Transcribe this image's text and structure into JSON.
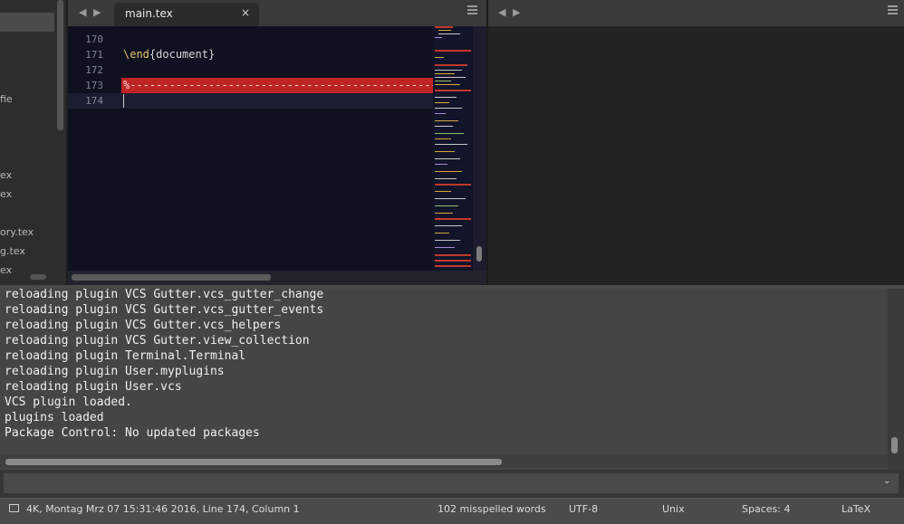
{
  "sidebar": {
    "items": [
      {
        "label": "fie"
      },
      {
        "label": "ex"
      },
      {
        "label": "ex"
      },
      {
        "label": "ory.tex"
      },
      {
        "label": "g.tex"
      },
      {
        "label": "ex"
      }
    ]
  },
  "tabs": {
    "left": {
      "active_tab": "main.tex",
      "close": "×"
    },
    "nav_back": "◀",
    "nav_forward": "▶"
  },
  "editor": {
    "lines": [
      {
        "num": "170",
        "code": ""
      },
      {
        "num": "171",
        "keyword": "\\end",
        "brace_open": "{",
        "arg": "document",
        "brace_close": "}"
      },
      {
        "num": "172",
        "code": ""
      },
      {
        "num": "173",
        "code": "%--------------------------------------------------"
      },
      {
        "num": "174",
        "code": ""
      }
    ]
  },
  "console": {
    "lines": [
      "reloading plugin VCS Gutter.vcs_gutter_change",
      "reloading plugin VCS Gutter.vcs_gutter_events",
      "reloading plugin VCS Gutter.vcs_helpers",
      "reloading plugin VCS Gutter.view_collection",
      "reloading plugin Terminal.Terminal",
      "reloading plugin User.myplugins",
      "reloading plugin User.vcs",
      "VCS plugin loaded.",
      "plugins loaded",
      "Package Control: No updated packages"
    ],
    "input_value": "",
    "chevron": "⌄"
  },
  "statusbar": {
    "info": "4K, Montag Mrz 07 15:31:46 2016, Line 174, Column 1",
    "spelling": "102 misspelled words",
    "encoding": "UTF-8",
    "line_endings": "Unix",
    "indentation": "Spaces: 4",
    "syntax": "LaTeX"
  },
  "colors": {
    "editor_bg": "#0f1120",
    "error_highlight": "#bf2424",
    "keyword": "#e6c46c"
  }
}
